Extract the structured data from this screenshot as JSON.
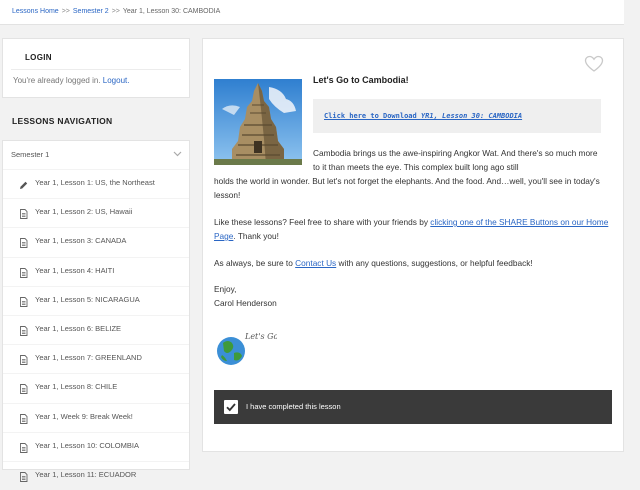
{
  "breadcrumb": {
    "home": "Lessons Home",
    "semester": "Semester 2",
    "current": "Year 1, Lesson 30: CAMBODIA",
    "separator": ">>"
  },
  "login": {
    "title": "LOGIN",
    "status_text": "You're already logged in.",
    "logout_link": "Logout."
  },
  "navigation": {
    "title": "LESSONS NAVIGATION",
    "semester_label": "Semester 1",
    "lessons": [
      {
        "label": "Year 1, Lesson 1: US, the Northeast",
        "icon": "pencil-icon"
      },
      {
        "label": "Year 1, Lesson 2: US, Hawaii",
        "icon": "document-icon"
      },
      {
        "label": "Year 1, Lesson 3: CANADA",
        "icon": "document-icon"
      },
      {
        "label": "Year 1, Lesson 4: HAITI",
        "icon": "document-icon"
      },
      {
        "label": "Year 1, Lesson 5: NICARAGUA",
        "icon": "document-icon"
      },
      {
        "label": "Year 1, Lesson 6: BELIZE",
        "icon": "document-icon"
      },
      {
        "label": "Year 1, Lesson 7: GREENLAND",
        "icon": "document-icon"
      },
      {
        "label": "Year 1, Lesson 8: CHILE",
        "icon": "document-icon"
      },
      {
        "label": "Year 1, Week 9: Break Week!",
        "icon": "document-icon"
      },
      {
        "label": "Year 1, Lesson 10: COLOMBIA",
        "icon": "document-icon"
      },
      {
        "label": "Year 1, Lesson 11: ECUADOR",
        "icon": "document-icon"
      }
    ]
  },
  "content": {
    "title": "Let's Go to Cambodia!",
    "download": {
      "prefix": "Click here to Download ",
      "emphasis": "YR1, Lesson 30: CAMBODIA"
    },
    "p1_line1": "Cambodia brings us the awe-inspiring Angkor Wat.  And there's so much more to it than meets the eye.  This complex built long ago still",
    "p1_line2": "holds the world in wonder.  But let's not forget the elephants.  And the food.  And…well, you'll see in today's lesson!",
    "p2_text": "Like these lessons?  Feel free to share with your friends by ",
    "p2_link": "clicking one of the SHARE Buttons on our Home Page",
    "p2_end": ".  Thank you!",
    "p3_text": "As always, be sure to ",
    "p3_link": "Contact Us",
    "p3_end": " with any questions, suggestions, or helpful feedback!",
    "closing": "Enjoy,",
    "signature": "Carol Henderson",
    "logo_text": "Let's Go",
    "complete_label": "I have completed this lesson"
  },
  "colors": {
    "link": "#2a66c4",
    "complete_bar": "#3a3a3a"
  }
}
